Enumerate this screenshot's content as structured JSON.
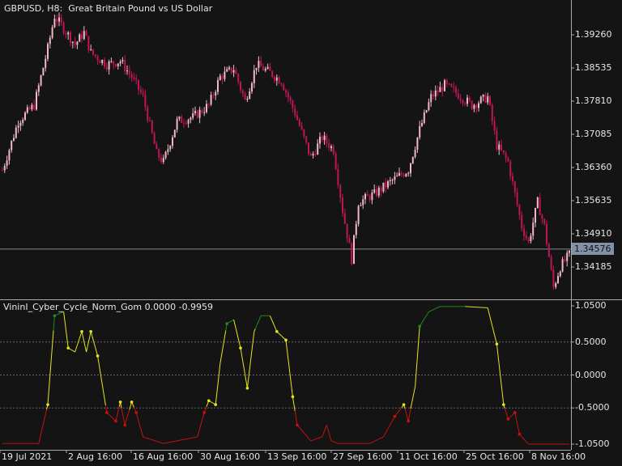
{
  "header": {
    "symbol": "GBPUSD, H8:",
    "description": "Great Britain Pound vs US Dollar"
  },
  "indicator_header": {
    "name": "VininI_Cyber_Cycle_Norm_Gom",
    "value1": "0.0000",
    "value2": "-0.9959"
  },
  "colors": {
    "bg": "#141414",
    "bull": "#f2b8c4",
    "bear": "#c01458",
    "grid": "#777777",
    "line_green": "#1e8c1e",
    "line_yellow": "#e6e61e",
    "line_red": "#cc1010"
  },
  "chart_data": [
    {
      "type": "candlestick",
      "title": "GBPUSD, H8",
      "ylim": [
        1.3355,
        1.3995
      ],
      "price_ticks": [
        "1.39260",
        "1.38535",
        "1.37810",
        "1.37085",
        "1.36360",
        "1.35635",
        "1.34910",
        "1.34185"
      ],
      "current_price": "1.34576",
      "anchors": [
        [
          0,
          1.363
        ],
        [
          7,
          1.3737
        ],
        [
          14,
          1.3772
        ],
        [
          20,
          1.3896
        ],
        [
          23,
          1.3967
        ],
        [
          27,
          1.394
        ],
        [
          32,
          1.3905
        ],
        [
          36,
          1.3931
        ],
        [
          39,
          1.3887
        ],
        [
          46,
          1.3861
        ],
        [
          52,
          1.3869
        ],
        [
          57,
          1.3834
        ],
        [
          62,
          1.379
        ],
        [
          68,
          1.3666
        ],
        [
          71,
          1.3648
        ],
        [
          77,
          1.3737
        ],
        [
          84,
          1.3746
        ],
        [
          91,
          1.3772
        ],
        [
          96,
          1.3834
        ],
        [
          102,
          1.3852
        ],
        [
          107,
          1.3781
        ],
        [
          112,
          1.3861
        ],
        [
          118,
          1.3843
        ],
        [
          123,
          1.3825
        ],
        [
          129,
          1.3755
        ],
        [
          136,
          1.3657
        ],
        [
          141,
          1.3702
        ],
        [
          146,
          1.3675
        ],
        [
          150,
          1.3542
        ],
        [
          154,
          1.3436
        ],
        [
          157,
          1.356
        ],
        [
          164,
          1.3578
        ],
        [
          171,
          1.3604
        ],
        [
          179,
          1.3631
        ],
        [
          184,
          1.3719
        ],
        [
          189,
          1.379
        ],
        [
          195,
          1.3816
        ],
        [
          200,
          1.3799
        ],
        [
          207,
          1.3772
        ],
        [
          214,
          1.379
        ],
        [
          218,
          1.3684
        ],
        [
          223,
          1.3648
        ],
        [
          229,
          1.3507
        ],
        [
          232,
          1.3472
        ],
        [
          236,
          1.356
        ],
        [
          239,
          1.3507
        ],
        [
          243,
          1.3374
        ],
        [
          246,
          1.3419
        ],
        [
          250,
          1.3445
        ]
      ]
    },
    {
      "type": "line",
      "title": "VininI_Cyber_Cycle_Norm_Gom",
      "ylim": [
        -1.05,
        1.05
      ],
      "ticks": [
        "1.0500",
        "0.5000",
        "0.0000",
        "-0.5000",
        "-1.0500"
      ],
      "levels": [
        0.5,
        0,
        -0.5
      ],
      "anchors": [
        [
          0,
          -1.04
        ],
        [
          16,
          -1.04
        ],
        [
          20,
          -0.45
        ],
        [
          23,
          0.9
        ],
        [
          27,
          0.96
        ],
        [
          29,
          0.41
        ],
        [
          32,
          0.35
        ],
        [
          35,
          0.66
        ],
        [
          37,
          0.35
        ],
        [
          39,
          0.66
        ],
        [
          42,
          0.29
        ],
        [
          46,
          -0.57
        ],
        [
          50,
          -0.7
        ],
        [
          52,
          -0.41
        ],
        [
          54,
          -0.76
        ],
        [
          57,
          -0.41
        ],
        [
          59,
          -0.57
        ],
        [
          62,
          -0.94
        ],
        [
          71,
          -1.04
        ],
        [
          86,
          -0.94
        ],
        [
          89,
          -0.57
        ],
        [
          91,
          -0.39
        ],
        [
          94,
          -0.45
        ],
        [
          96,
          0.17
        ],
        [
          99,
          0.78
        ],
        [
          102,
          0.84
        ],
        [
          105,
          0.41
        ],
        [
          108,
          -0.2
        ],
        [
          111,
          0.66
        ],
        [
          114,
          0.9
        ],
        [
          118,
          0.9
        ],
        [
          121,
          0.66
        ],
        [
          125,
          0.53
        ],
        [
          128,
          -0.33
        ],
        [
          130,
          -0.76
        ],
        [
          136,
          -1.0
        ],
        [
          141,
          -0.94
        ],
        [
          143,
          -0.76
        ],
        [
          145,
          -1.0
        ],
        [
          148,
          -1.04
        ],
        [
          162,
          -1.04
        ],
        [
          168,
          -0.94
        ],
        [
          173,
          -0.63
        ],
        [
          177,
          -0.45
        ],
        [
          179,
          -0.7
        ],
        [
          180,
          -0.51
        ],
        [
          182,
          -0.18
        ],
        [
          184,
          0.74
        ],
        [
          188,
          0.96
        ],
        [
          193,
          1.04
        ],
        [
          204,
          1.04
        ],
        [
          214,
          1.02
        ],
        [
          218,
          0.47
        ],
        [
          221,
          -0.45
        ],
        [
          223,
          -0.67
        ],
        [
          226,
          -0.57
        ],
        [
          228,
          -0.9
        ],
        [
          232,
          -1.05
        ],
        [
          250,
          -1.05
        ]
      ],
      "dots": [
        20,
        23,
        29,
        35,
        39,
        42,
        46,
        50,
        52,
        54,
        57,
        59,
        89,
        91,
        94,
        99,
        105,
        108,
        121,
        125,
        128,
        130,
        173,
        177,
        179,
        184,
        218,
        221,
        223,
        226,
        228
      ]
    }
  ],
  "xaxis": {
    "labels": [
      "19 Jul 2021",
      "2 Aug 16:00",
      "16 Aug 16:00",
      "30 Aug 16:00",
      "13 Sep 16:00",
      "27 Sep 16:00",
      "11 Oct 16:00",
      "25 Oct 16:00",
      "8 Nov 16:00"
    ]
  }
}
